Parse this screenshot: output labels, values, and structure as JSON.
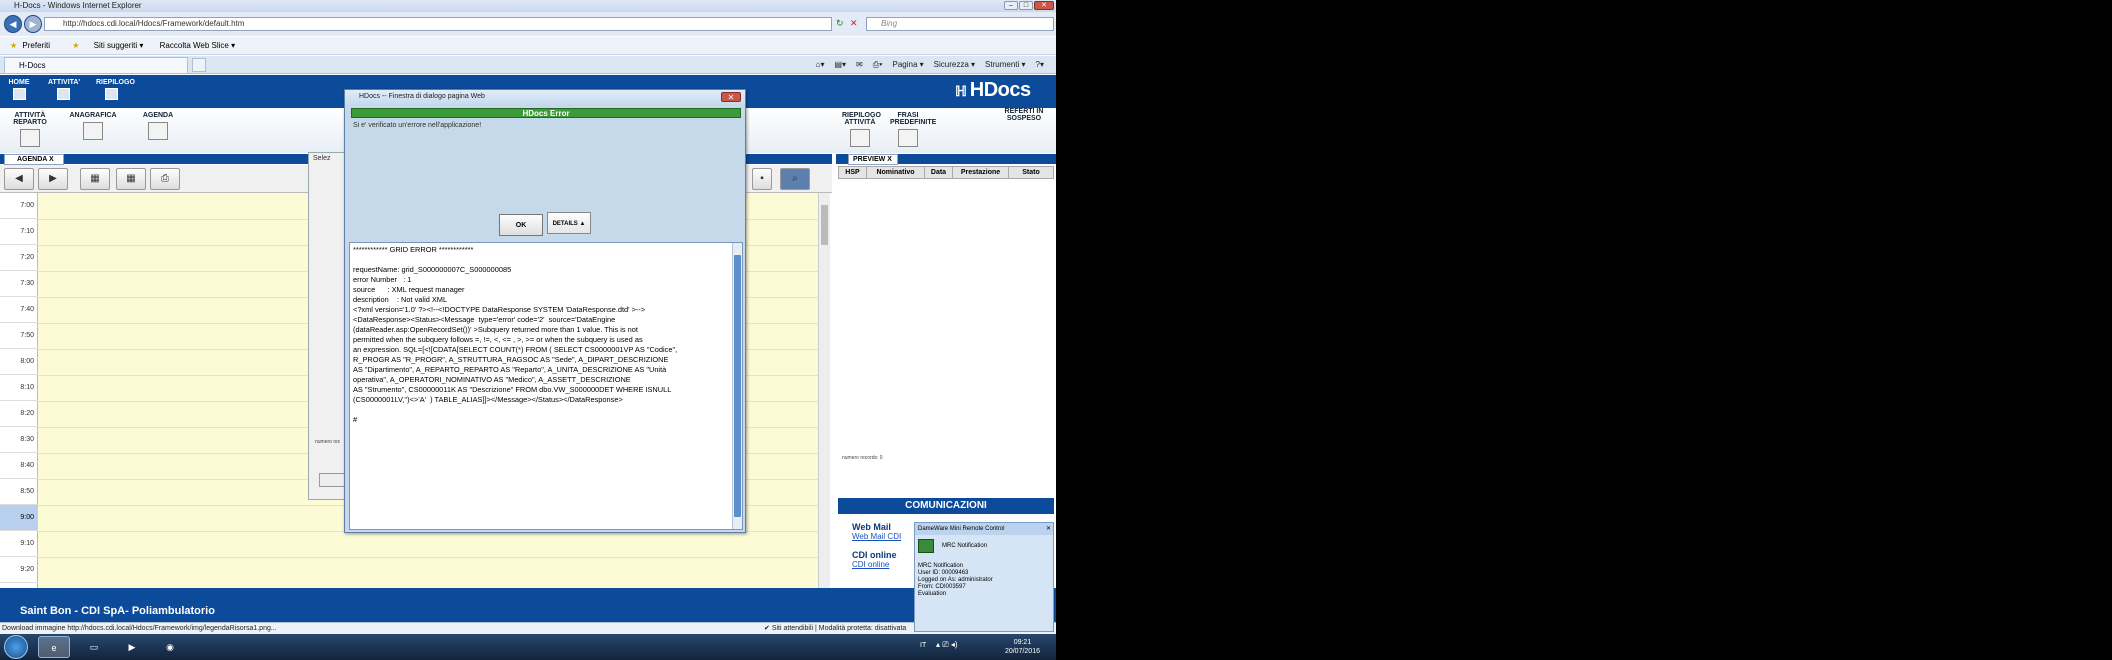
{
  "browser": {
    "title": "H-Docs - Windows Internet Explorer",
    "url": "http://hdocs.cdi.local/Hdocs/Framework/default.htm",
    "search_placeholder": "Bing",
    "favorites": [
      "Preferiti",
      "Siti suggeriti ▾",
      "Raccolta Web Slice ▾"
    ],
    "tab_title": "H-Docs",
    "commands": [
      "Pagina ▾",
      "Sicurezza ▾",
      "Strumenti ▾",
      "?▾"
    ],
    "status_text": "Download immagine http://hdocs.cdi.local/Hdocs/Framework/img/legendaRisorsa1.png...",
    "status_right": "Siti attendibili | Modalità protetta: disattivata"
  },
  "app": {
    "menu": [
      "HOME",
      "ATTIVITA'",
      "RIEPILOGO"
    ],
    "logo": "HDocs",
    "sub_left": [
      "ATTIVITÀ REPARTO",
      "ANAGRAFICA",
      "AGENDA"
    ],
    "sub_right": [
      "RIEPILOGO ATTIVITÀ",
      "FRASI PREDEFINITE",
      "REFERTI IN SOSPESO"
    ],
    "agenda_tab": "AGENDA   X",
    "preview_tab": "PREVIEW   X",
    "preview_columns": [
      "HSP",
      "Nominativo",
      "Data",
      "Prestazione",
      "Stato"
    ],
    "numero_record": "numero records:  0",
    "numero_record_left": "numero rec",
    "footer": "Saint Bon - CDI SpA- Poliambulatorio",
    "bg_dialog_title": "Selez"
  },
  "times": [
    "7:00",
    "7:10",
    "7:20",
    "7:30",
    "7:40",
    "7:50",
    "8:00",
    "8:10",
    "8:20",
    "8:30",
    "8:40",
    "8:50",
    "9:00",
    "9:10",
    "9:20"
  ],
  "highlight_time": "9:00",
  "comunicazioni": {
    "title": "COMUNICAZIONI",
    "webmail_title": "Web Mail",
    "webmail_link": "Web Mail CDI",
    "cdi_title": "CDI online",
    "cdi_link": "CDI online"
  },
  "dialog": {
    "title": "HDocs -- Finestra di dialogo pagina Web",
    "header": "HDocs Error",
    "message": "Si e' verificato un'errore nell'applicazione!",
    "ok": "OK",
    "details": "DETAILS ▲",
    "details_text": "************ GRID ERROR ************\n\nrequestName: grid_S000000007C_S000000085\nerror Number   : 1\nsource      : XML request manager\ndescription    : Not valid XML\n<?xml version='1.0' ?><!--<!DOCTYPE DataResponse SYSTEM 'DataResponse.dtd' >-->\n<DataResponse><Status><Message  type='error' code='2'  source='DataEngine\n(dataReader.asp:OpenRecordSet())' >Subquery returned more than 1 value. This is not\npermitted when the subquery follows =, !=, <, <= , >, >= or when the subquery is used as\nan expression. SQL=[<![CDATA[SELECT COUNT(*) FROM ( SELECT CS0000001VP AS \"Codice\",\nR_PROGR AS \"R_PROGR\", A_STRUTTURA_RAGSOC AS \"Sede\", A_DIPART_DESCRIZIONE\nAS \"Dipartimento\", A_REPARTO_REPARTO AS \"Reparto\", A_UNITA_DESCRIZIONE AS \"Unità\noperativa\", A_OPERATORI_NOMINATIVO AS \"Medico\", A_ASSETT_DESCRIZIONE\nAS \"Strumento\", CS00000011K AS \"Descrizione\" FROM dbo.VW_S000000DET WHERE ISNULL\n(CS0000001LV,'')<>'A'  ) TABLE_ALIAS]]></Message></Status></DataResponse>\n\n#"
  },
  "notification": {
    "title": "DameWare Mini Remote Control",
    "subtitle": "MRC Notification",
    "lines": [
      "MRC Notification",
      "User ID: 00009463",
      "Logged on As: administrator",
      "From: CDI003597",
      "Evaluation"
    ]
  },
  "taskbar": {
    "lang": "IT",
    "time": "09:21",
    "date": "20/07/2016"
  }
}
